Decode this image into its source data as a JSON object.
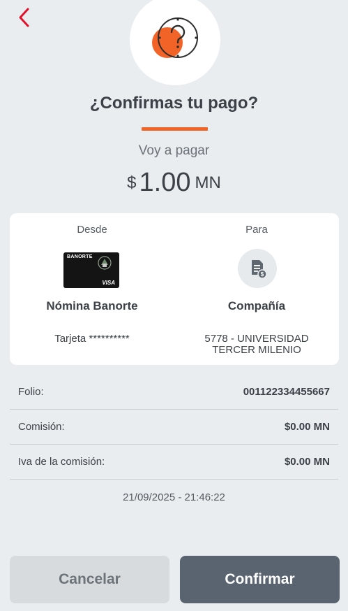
{
  "header": {
    "back_icon": "chevron-left-icon"
  },
  "hero": {
    "icon": "question-coin-icon"
  },
  "title": "¿Confirmas tu pago?",
  "subtitle": "Voy a pagar",
  "amount": {
    "currency": "$",
    "value": "1.00",
    "unit": "MN"
  },
  "from": {
    "heading": "Desde",
    "card_brand": "BANORTE",
    "card_network": "VISA",
    "name": "Nómina Banorte",
    "detail": "Tarjeta **********"
  },
  "to": {
    "heading": "Para",
    "icon": "document-payment-icon",
    "name": "Compañía",
    "detail_line1": "5778 - UNIVERSIDAD",
    "detail_line2": "TERCER MILENIO"
  },
  "details": [
    {
      "label": "Folio:",
      "value": "001122334455667"
    },
    {
      "label": "Comisión:",
      "value": "$0.00 MN"
    },
    {
      "label": "Iva de la comisión:",
      "value": "$0.00 MN"
    }
  ],
  "timestamp": "21/09/2025 - 21:46:22",
  "actions": {
    "cancel": "Cancelar",
    "confirm": "Confirmar"
  },
  "colors": {
    "accent": "#f26328",
    "back": "#e3112a",
    "confirm_bg": "#5a6470",
    "cancel_bg": "#d7dbde"
  }
}
